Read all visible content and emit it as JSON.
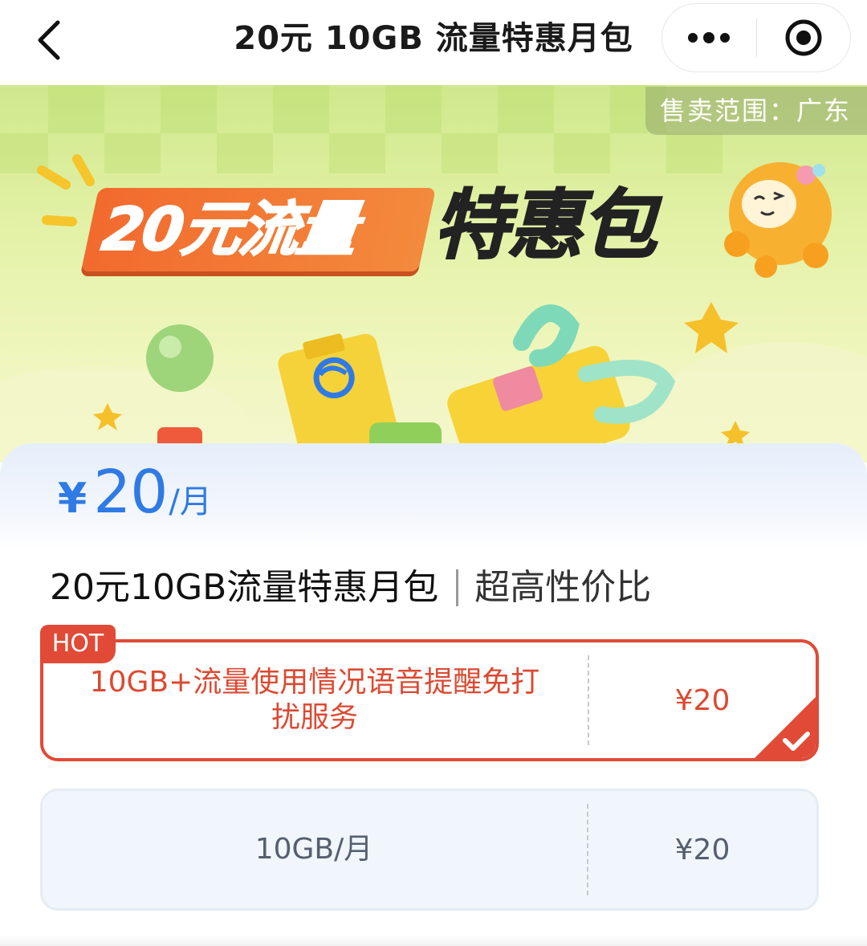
{
  "navbar": {
    "title": "20元 10GB 流量特惠月包",
    "back_icon": "chevron-left-icon",
    "more_icon": "more-dots-icon",
    "close_icon": "target-circle-icon"
  },
  "banner": {
    "region_label": "售卖范围：广东",
    "title_highlight": "20元流量",
    "title_main": "特惠包",
    "colors": {
      "orange": "#f26a2e",
      "background": "#d9ee9c"
    }
  },
  "price": {
    "symbol": "¥",
    "amount": "20",
    "unit": "/月",
    "color": "#2f7ae5"
  },
  "plan": {
    "name": "20元10GB流量特惠月包",
    "tag": "超高性价比"
  },
  "options": [
    {
      "badge": "HOT",
      "description": "10GB+流量使用情况语音提醒免打扰服务",
      "price": "¥20",
      "selected": true,
      "accent_color": "#e04a36"
    },
    {
      "description": "10GB/月",
      "price": "¥20",
      "selected": false
    }
  ]
}
